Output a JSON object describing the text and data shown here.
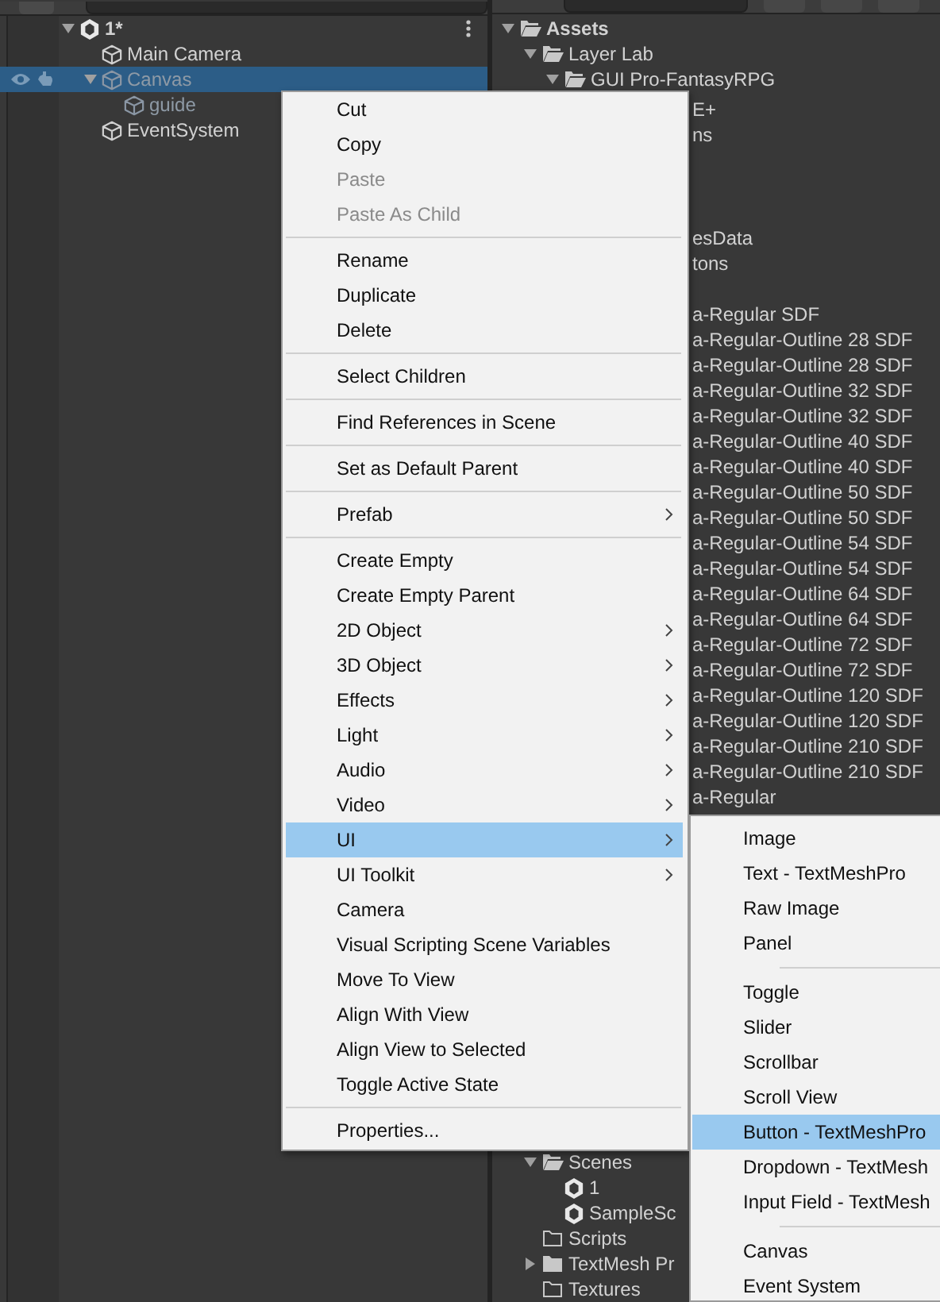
{
  "hierarchy": {
    "scene": {
      "name": "1*",
      "expanded": true,
      "children": [
        {
          "name": "Main Camera",
          "active": true,
          "selected": false
        },
        {
          "name": "Canvas",
          "active": false,
          "selected": true,
          "expanded": true,
          "children": [
            {
              "name": "guide",
              "active": false,
              "selected": false
            }
          ]
        },
        {
          "name": "EventSystem",
          "active": true,
          "selected": false
        }
      ]
    }
  },
  "project": {
    "tree_top": [
      {
        "name": "Assets",
        "kind": "folder",
        "expanded": true,
        "children": [
          {
            "name": "Layer Lab",
            "kind": "folder",
            "expanded": true,
            "children": [
              {
                "name": "GUI Pro-FantasyRPG",
                "kind": "folder",
                "expanded": true
              }
            ]
          }
        ]
      }
    ],
    "covered_groups": [
      [
        "E+",
        "ns"
      ],
      [
        "esData",
        "tons"
      ],
      [
        "a-Regular SDF",
        "a-Regular-Outline 28 SDF",
        "a-Regular-Outline 28 SDF",
        "a-Regular-Outline 32 SDF",
        "a-Regular-Outline 32 SDF",
        "a-Regular-Outline 40 SDF",
        "a-Regular-Outline 40 SDF",
        "a-Regular-Outline 50 SDF",
        "a-Regular-Outline 50 SDF",
        "a-Regular-Outline 54 SDF",
        "a-Regular-Outline 54 SDF",
        "a-Regular-Outline 64 SDF",
        "a-Regular-Outline 64 SDF",
        "a-Regular-Outline 72 SDF",
        "a-Regular-Outline 72 SDF",
        "a-Regular-Outline 120 SDF",
        "a-Regular-Outline 120 SDF",
        "a-Regular-Outline 210 SDF",
        "a-Regular-Outline 210 SDF",
        "a-Regular"
      ]
    ],
    "tree_bottom": [
      {
        "name": "Scenes",
        "kind": "folder",
        "expanded": true,
        "children": [
          {
            "name": "1",
            "kind": "scene"
          },
          {
            "name": "SampleSc",
            "kind": "scene"
          }
        ]
      },
      {
        "name": "Scripts",
        "kind": "folder"
      },
      {
        "name": "TextMesh Pr",
        "kind": "folder",
        "expanded": false
      },
      {
        "name": "Textures",
        "kind": "folder"
      }
    ]
  },
  "context_menu": {
    "items": [
      {
        "kind": "item",
        "label": "Cut",
        "disabled": false,
        "submenu": false,
        "selected": false
      },
      {
        "kind": "item",
        "label": "Copy",
        "disabled": false,
        "submenu": false,
        "selected": false
      },
      {
        "kind": "item",
        "label": "Paste",
        "disabled": true,
        "submenu": false,
        "selected": false
      },
      {
        "kind": "item",
        "label": "Paste As Child",
        "disabled": true,
        "submenu": false,
        "selected": false
      },
      {
        "kind": "separator"
      },
      {
        "kind": "item",
        "label": "Rename",
        "disabled": false,
        "submenu": false,
        "selected": false
      },
      {
        "kind": "item",
        "label": "Duplicate",
        "disabled": false,
        "submenu": false,
        "selected": false
      },
      {
        "kind": "item",
        "label": "Delete",
        "disabled": false,
        "submenu": false,
        "selected": false
      },
      {
        "kind": "separator"
      },
      {
        "kind": "item",
        "label": "Select Children",
        "disabled": false,
        "submenu": false,
        "selected": false
      },
      {
        "kind": "separator"
      },
      {
        "kind": "item",
        "label": "Find References in Scene",
        "disabled": false,
        "submenu": false,
        "selected": false
      },
      {
        "kind": "separator"
      },
      {
        "kind": "item",
        "label": "Set as Default Parent",
        "disabled": false,
        "submenu": false,
        "selected": false
      },
      {
        "kind": "separator"
      },
      {
        "kind": "item",
        "label": "Prefab",
        "disabled": false,
        "submenu": true,
        "selected": false
      },
      {
        "kind": "separator"
      },
      {
        "kind": "item",
        "label": "Create Empty",
        "disabled": false,
        "submenu": false,
        "selected": false
      },
      {
        "kind": "item",
        "label": "Create Empty Parent",
        "disabled": false,
        "submenu": false,
        "selected": false
      },
      {
        "kind": "item",
        "label": "2D Object",
        "disabled": false,
        "submenu": true,
        "selected": false
      },
      {
        "kind": "item",
        "label": "3D Object",
        "disabled": false,
        "submenu": true,
        "selected": false
      },
      {
        "kind": "item",
        "label": "Effects",
        "disabled": false,
        "submenu": true,
        "selected": false
      },
      {
        "kind": "item",
        "label": "Light",
        "disabled": false,
        "submenu": true,
        "selected": false
      },
      {
        "kind": "item",
        "label": "Audio",
        "disabled": false,
        "submenu": true,
        "selected": false
      },
      {
        "kind": "item",
        "label": "Video",
        "disabled": false,
        "submenu": true,
        "selected": false
      },
      {
        "kind": "item",
        "label": "UI",
        "disabled": false,
        "submenu": true,
        "selected": true
      },
      {
        "kind": "item",
        "label": "UI Toolkit",
        "disabled": false,
        "submenu": true,
        "selected": false
      },
      {
        "kind": "item",
        "label": "Camera",
        "disabled": false,
        "submenu": false,
        "selected": false
      },
      {
        "kind": "item",
        "label": "Visual Scripting Scene Variables",
        "disabled": false,
        "submenu": false,
        "selected": false
      },
      {
        "kind": "item",
        "label": "Move To View",
        "disabled": false,
        "submenu": false,
        "selected": false
      },
      {
        "kind": "item",
        "label": "Align With View",
        "disabled": false,
        "submenu": false,
        "selected": false
      },
      {
        "kind": "item",
        "label": "Align View to Selected",
        "disabled": false,
        "submenu": false,
        "selected": false
      },
      {
        "kind": "item",
        "label": "Toggle Active State",
        "disabled": false,
        "submenu": false,
        "selected": false
      },
      {
        "kind": "separator"
      },
      {
        "kind": "item",
        "label": "Properties...",
        "disabled": false,
        "submenu": false,
        "selected": false
      }
    ]
  },
  "submenu": {
    "items": [
      {
        "kind": "item",
        "label": "Image",
        "selected": false
      },
      {
        "kind": "item",
        "label": "Text - TextMeshPro",
        "selected": false
      },
      {
        "kind": "item",
        "label": "Raw Image",
        "selected": false
      },
      {
        "kind": "item",
        "label": "Panel",
        "selected": false
      },
      {
        "kind": "separator"
      },
      {
        "kind": "item",
        "label": "Toggle",
        "selected": false
      },
      {
        "kind": "item",
        "label": "Slider",
        "selected": false
      },
      {
        "kind": "item",
        "label": "Scrollbar",
        "selected": false
      },
      {
        "kind": "item",
        "label": "Scroll View",
        "selected": false
      },
      {
        "kind": "item",
        "label": "Button - TextMeshPro",
        "selected": true
      },
      {
        "kind": "item",
        "label": "Dropdown - TextMesh",
        "selected": false
      },
      {
        "kind": "item",
        "label": "Input Field - TextMesh",
        "selected": false
      },
      {
        "kind": "separator"
      },
      {
        "kind": "item",
        "label": "Canvas",
        "selected": false
      },
      {
        "kind": "item",
        "label": "Event System",
        "selected": false
      }
    ]
  }
}
